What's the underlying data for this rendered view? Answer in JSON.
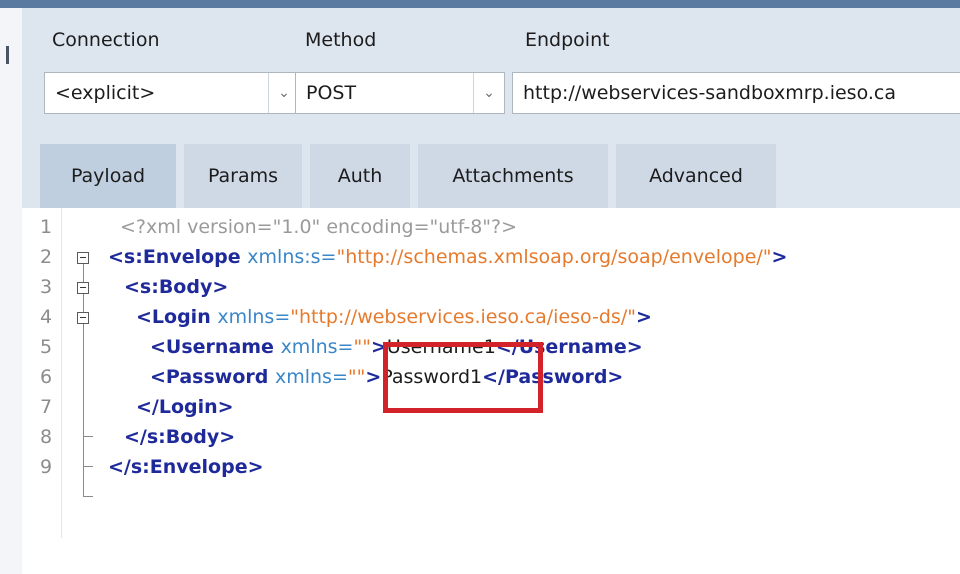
{
  "connection": {
    "label": "Connection",
    "value": "<explicit>"
  },
  "method": {
    "label": "Method",
    "value": "POST"
  },
  "endpoint": {
    "label": "Endpoint",
    "value": "http://webservices-sandboxmrp.ieso.ca"
  },
  "tabs": [
    {
      "label": "Payload"
    },
    {
      "label": "Params"
    },
    {
      "label": "Auth"
    },
    {
      "label": "Attachments"
    },
    {
      "label": "Advanced"
    }
  ],
  "editor": {
    "line_numbers": [
      "1",
      "2",
      "3",
      "4",
      "5",
      "6",
      "7",
      "8",
      "9"
    ],
    "lines": [
      {
        "decl": "<?xml version=\"1.0\" encoding=\"utf-8\"?>"
      },
      {
        "tag_open": "<s:Envelope ",
        "attr": "xmlns:s=",
        "value": "\"http://schemas.xmlsoap.org/soap/envelope/\"",
        "tag_close": ">"
      },
      {
        "tag": "<s:Body>"
      },
      {
        "tag_open": "<Login ",
        "attr": "xmlns=",
        "value": "\"http://webservices.ieso.ca/ieso-ds/\"",
        "tag_close": ">"
      },
      {
        "tag_open": "<Username ",
        "attr": "xmlns=",
        "value": "\"\"",
        "gt": ">",
        "text": "Username1",
        "end_tag": "</Username>"
      },
      {
        "tag_open": "<Password ",
        "attr": "xmlns=",
        "value": "\"\"",
        "gt": ">",
        "text": "Password1",
        "end_tag": "</Password>"
      },
      {
        "tag": "</Login>"
      },
      {
        "tag": "</s:Body>"
      },
      {
        "tag": "</s:Envelope>"
      }
    ]
  }
}
